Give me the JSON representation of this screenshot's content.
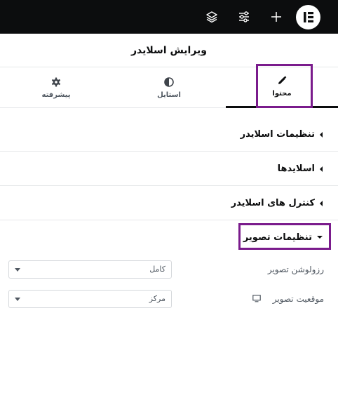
{
  "topbar": {
    "icons": [
      "layers-icon",
      "sliders-icon",
      "plus-icon",
      "elementor-logo"
    ]
  },
  "header": {
    "title": "ویرایش اسلایدر"
  },
  "tabs": [
    {
      "label": "محتوا",
      "icon": "pencil-icon",
      "active": true
    },
    {
      "label": "استایل",
      "icon": "half-circle-icon",
      "active": false
    },
    {
      "label": "پیشرفته",
      "icon": "gear-icon",
      "active": false
    }
  ],
  "sections": [
    {
      "label": "تنظیمات اسلایدر",
      "expanded": false
    },
    {
      "label": "اسلایدها",
      "expanded": false
    },
    {
      "label": "کنترل های اسلایدر",
      "expanded": false
    },
    {
      "label": "تنظیمات تصویر",
      "expanded": true
    }
  ],
  "fields": {
    "resolution": {
      "label": "رزولوشن تصویر",
      "value": "کامل"
    },
    "position": {
      "label": "موقعیت تصویر",
      "value": "مرکز",
      "icon": "desktop-icon"
    }
  },
  "colors": {
    "topbar": "#0c0d0e",
    "highlight": "#7a1b8c"
  }
}
